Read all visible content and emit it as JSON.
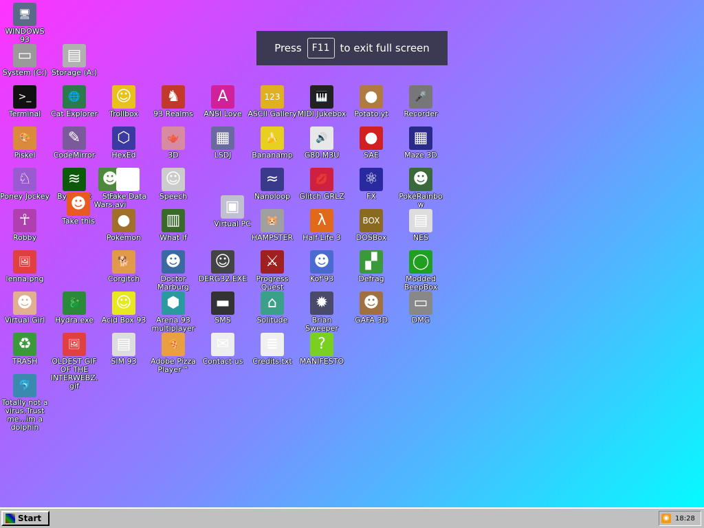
{
  "fullscreen_notice": {
    "before": "Press",
    "key": "F11",
    "after": "to exit full screen"
  },
  "taskbar": {
    "start_label": "Start",
    "clock": "18:28"
  },
  "desktop_icons": [
    {
      "id": "windows93",
      "label": "WINDOWS 93",
      "icon": "computer-icon",
      "color": "#5a6a8a",
      "glyph": "🖥"
    },
    {
      "id": "system-c",
      "label": "System (C:)",
      "icon": "drive-icon",
      "color": "#9a9a9a",
      "glyph": "▭"
    },
    {
      "id": "storage-a",
      "label": "Storage (A:)",
      "icon": "floppy-drive-icon",
      "color": "#b0b0b0",
      "glyph": "▤"
    },
    {
      "id": "terminal",
      "label": "Terminal",
      "icon": "terminal-icon",
      "color": "#111111",
      "glyph": ">_"
    },
    {
      "id": "cat-explorer",
      "label": "Cat Explorer",
      "icon": "globe-cat-icon",
      "color": "#2a7a4a",
      "glyph": "🌐"
    },
    {
      "id": "trollbox",
      "label": "Trollbox",
      "icon": "chat-smiley-icon",
      "color": "#e8c21a",
      "glyph": "☺"
    },
    {
      "id": "93-realms",
      "label": "93 Realms",
      "icon": "knight-icon",
      "color": "#c0392b",
      "glyph": "♞"
    },
    {
      "id": "ansi-love",
      "label": "ANSI Love",
      "icon": "letter-a-icon",
      "color": "#d0209a",
      "glyph": "A"
    },
    {
      "id": "ascii-gallery",
      "label": "ASCII Gallery",
      "icon": "numbers-icon",
      "color": "#e0b020",
      "glyph": "123"
    },
    {
      "id": "midi-jukebox",
      "label": "MIDI Jukebox",
      "icon": "piano-icon",
      "color": "#222222",
      "glyph": "🎹"
    },
    {
      "id": "potato-yt",
      "label": "Potato.yt",
      "icon": "potato-icon",
      "color": "#b07a40",
      "glyph": "●"
    },
    {
      "id": "recorder",
      "label": "Recorder",
      "icon": "microphone-icon",
      "color": "#777777",
      "glyph": "🎤"
    },
    {
      "id": "piskel",
      "label": "Piskel",
      "icon": "palette-icon",
      "color": "#d98a3a",
      "glyph": "🎨"
    },
    {
      "id": "codemirror",
      "label": "CodeMirror",
      "icon": "code-icon",
      "color": "#7a5a9a",
      "glyph": "✎"
    },
    {
      "id": "hexed",
      "label": "HexEd",
      "icon": "cube-icon",
      "color": "#3a3aa0",
      "glyph": "⬡"
    },
    {
      "id": "3d",
      "label": "3D",
      "icon": "teapot-icon",
      "color": "#d88aa0",
      "glyph": "🫖"
    },
    {
      "id": "lsdj",
      "label": "LSDJ",
      "icon": "gameboy-icon",
      "color": "#6a6aa0",
      "glyph": "▦"
    },
    {
      "id": "bananamp",
      "label": "Bananamp",
      "icon": "banana-icon",
      "color": "#e8d020",
      "glyph": "🍌"
    },
    {
      "id": "g80-m3u",
      "label": "G80.M3U",
      "icon": "speaker-icon",
      "color": "#e8e8e8",
      "glyph": "🔊"
    },
    {
      "id": "sae",
      "label": "SAE",
      "icon": "boing-ball-icon",
      "color": "#d02020",
      "glyph": "●"
    },
    {
      "id": "maze-3d",
      "label": "Maze 3D",
      "icon": "maze-icon",
      "color": "#2a2a8a",
      "glyph": "▦"
    },
    {
      "id": "poney-jockey",
      "label": "Poney Jockey",
      "icon": "pony-icon",
      "color": "#9a5ad0",
      "glyph": "♘"
    },
    {
      "id": "bytebeat",
      "label": "Bytebeat",
      "icon": "waveform-icon",
      "color": "#0a5a0a",
      "glyph": "≋"
    },
    {
      "id": "star-wars",
      "label": "Star Wars.avi",
      "icon": "yoda-icon",
      "color": "#4a8a3a",
      "glyph": "☻"
    },
    {
      "id": "fake-data",
      "label": "Fake Data",
      "icon": "pd-icon",
      "color": "#ffffff",
      "glyph": "Pd"
    },
    {
      "id": "speech",
      "label": "Speech",
      "icon": "face-icon",
      "color": "#cccccc",
      "glyph": "☺"
    },
    {
      "id": "nanoloop",
      "label": "Nanoloop",
      "icon": "loop-icon",
      "color": "#3a3a8a",
      "glyph": "≈"
    },
    {
      "id": "glitch-grlz",
      "label": "Glitch GRLZ",
      "icon": "lips-icon",
      "color": "#d02040",
      "glyph": "💋"
    },
    {
      "id": "fx",
      "label": "FX",
      "icon": "atom-icon",
      "color": "#2a2aa0",
      "glyph": "⚛"
    },
    {
      "id": "pokerainbow",
      "label": "PokéRainbow",
      "icon": "characters-icon",
      "color": "#3a6a3a",
      "glyph": "☻"
    },
    {
      "id": "take-this",
      "label": "Take this",
      "icon": "old-man-icon",
      "color": "#e85a20",
      "glyph": "☻"
    },
    {
      "id": "virtual-pc",
      "label": "Virtual PC",
      "icon": "window-icon",
      "color": "#c0c0d0",
      "glyph": "▣"
    },
    {
      "id": "robby",
      "label": "Robby",
      "icon": "stick-figure-icon",
      "color": "#b040b0",
      "glyph": "☥"
    },
    {
      "id": "pokemon",
      "label": "Pokémon",
      "icon": "pokemon-icon",
      "color": "#a0702a",
      "glyph": "●"
    },
    {
      "id": "what-if",
      "label": "What If",
      "icon": "grid-icon",
      "color": "#3a6a2a",
      "glyph": "▥"
    },
    {
      "id": "hampster",
      "label": "HAMPSTER",
      "icon": "hamster-icon",
      "color": "#a0a0a0",
      "glyph": "🐹"
    },
    {
      "id": "half-life-3",
      "label": "Half-Life 3",
      "icon": "lambda-icon",
      "color": "#e06a1a",
      "glyph": "λ"
    },
    {
      "id": "dosbox",
      "label": "DOSBox",
      "icon": "dosbox-icon",
      "color": "#8a6a20",
      "glyph": "BOX"
    },
    {
      "id": "nes",
      "label": "NES",
      "icon": "nes-icon",
      "color": "#dddddd",
      "glyph": "▤"
    },
    {
      "id": "lenna",
      "label": "lenna.png",
      "icon": "image-file-icon",
      "color": "#e04040",
      "glyph": "🖼"
    },
    {
      "id": "corgitch",
      "label": "Corgitch",
      "icon": "corgi-icon",
      "color": "#e09a4a",
      "glyph": "🐕"
    },
    {
      "id": "doctor-marburg",
      "label": "Doctor Marburg",
      "icon": "doctor-icon",
      "color": "#3a6aa0",
      "glyph": "☻"
    },
    {
      "id": "derg32",
      "label": "DERG32.EXE",
      "icon": "monitor-face-icon",
      "color": "#444444",
      "glyph": "☺"
    },
    {
      "id": "progress-quest",
      "label": "Progress Quest",
      "icon": "crossed-swords-icon",
      "color": "#a02020",
      "glyph": "⚔"
    },
    {
      "id": "kof93",
      "label": "Kof'93",
      "icon": "fighter-icon",
      "color": "#4a6ad0",
      "glyph": "☻"
    },
    {
      "id": "defrag",
      "label": "Defrag",
      "icon": "defrag-icon",
      "color": "#3a9a3a",
      "glyph": "▞"
    },
    {
      "id": "modded-beepbox",
      "label": "Modded BeepBox",
      "icon": "ring-icon",
      "color": "#20a020",
      "glyph": "◯"
    },
    {
      "id": "virtual-girl",
      "label": "Virtual Girl",
      "icon": "girl-face-icon",
      "color": "#e0b090",
      "glyph": "☻"
    },
    {
      "id": "hydra",
      "label": "Hydra.exe",
      "icon": "dragon-icon",
      "color": "#2a8a3a",
      "glyph": "🐉"
    },
    {
      "id": "acid-box",
      "label": "Acid Box 93",
      "icon": "acid-smiley-icon",
      "color": "#e8e820",
      "glyph": "☺"
    },
    {
      "id": "arena-93",
      "label": "Arena 93 multiplayer",
      "icon": "arena-cube-icon",
      "color": "#2a9aa0",
      "glyph": "⬢"
    },
    {
      "id": "sms",
      "label": "SMS",
      "icon": "console-icon",
      "color": "#333333",
      "glyph": "▬"
    },
    {
      "id": "solitude",
      "label": "Solitude",
      "icon": "jar-icon",
      "color": "#3aa08a",
      "glyph": "⌂"
    },
    {
      "id": "brian-sweeper",
      "label": "Brian Sweeper",
      "icon": "mine-icon",
      "color": "#4a4a6a",
      "glyph": "✹"
    },
    {
      "id": "gafa-3d",
      "label": "GAFA 3D",
      "icon": "doom-face-icon",
      "color": "#a07040",
      "glyph": "☻"
    },
    {
      "id": "dmg",
      "label": "DMG",
      "icon": "gameboy-dmg-icon",
      "color": "#888888",
      "glyph": "▭"
    },
    {
      "id": "trash",
      "label": "TRASH",
      "icon": "trash-icon",
      "color": "#3a9a3a",
      "glyph": "♻"
    },
    {
      "id": "oldest-gif",
      "label": "OLDEST GIF OF THE INTERWEBZ.gif",
      "icon": "gif-file-icon",
      "color": "#e04040",
      "glyph": "🖼"
    },
    {
      "id": "sim93",
      "label": "SIM 93",
      "icon": "sim-card-icon",
      "color": "#dddddd",
      "glyph": "▤"
    },
    {
      "id": "adobe-pizza",
      "label": "Adobe Pizza Player™",
      "icon": "pizza-icon",
      "color": "#e8a040",
      "glyph": "🍕"
    },
    {
      "id": "contact-us",
      "label": "Contact us",
      "icon": "letter-pen-icon",
      "color": "#eeeeee",
      "glyph": "✉"
    },
    {
      "id": "credits",
      "label": "Credits.txt",
      "icon": "text-file-icon",
      "color": "#f0f0f0",
      "glyph": "≣"
    },
    {
      "id": "manifesto",
      "label": "MANIFESTO",
      "icon": "question-mark-icon",
      "color": "#7ad020",
      "glyph": "?"
    },
    {
      "id": "dolphin",
      "label": "Totally not a virus.Trust me...im a dolphin",
      "icon": "dolphin-icon",
      "color": "#3a8ab0",
      "glyph": "🐬"
    }
  ]
}
